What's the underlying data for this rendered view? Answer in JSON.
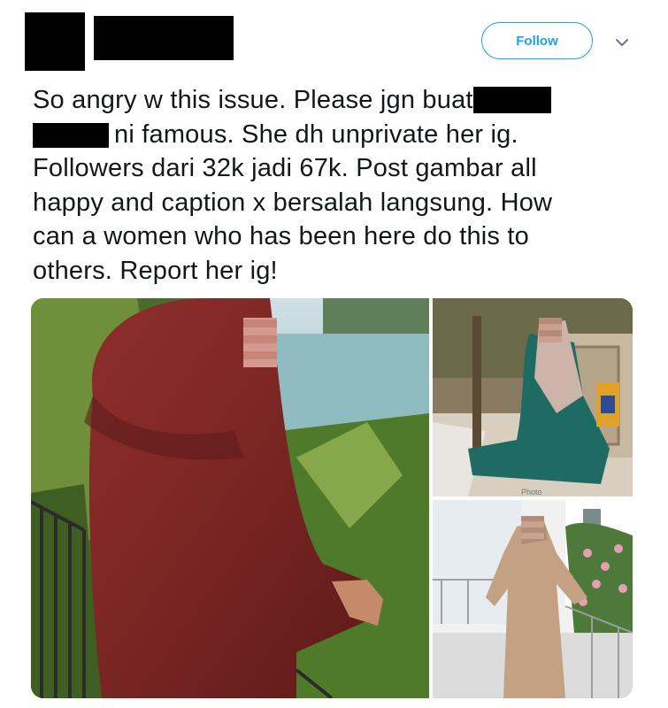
{
  "header": {
    "follow_label": "Follow",
    "menu_icon": "chevron-down-icon"
  },
  "tweet": {
    "text_line1": "So angry w this issue. Please jgn buat",
    "text_line2": "ni famous. She dh unprivate her ig.",
    "text_line3": "Followers dari 32k jadi 67k. Post gambar all",
    "text_line4": "happy and caption x bersalah langsung. How",
    "text_line5": "can a women who has been here do this to",
    "text_line6": "others. Report her ig!"
  },
  "media": {
    "photo_caption": "Photo"
  },
  "colors": {
    "accent": "#1da1f2",
    "text": "#14171a"
  }
}
